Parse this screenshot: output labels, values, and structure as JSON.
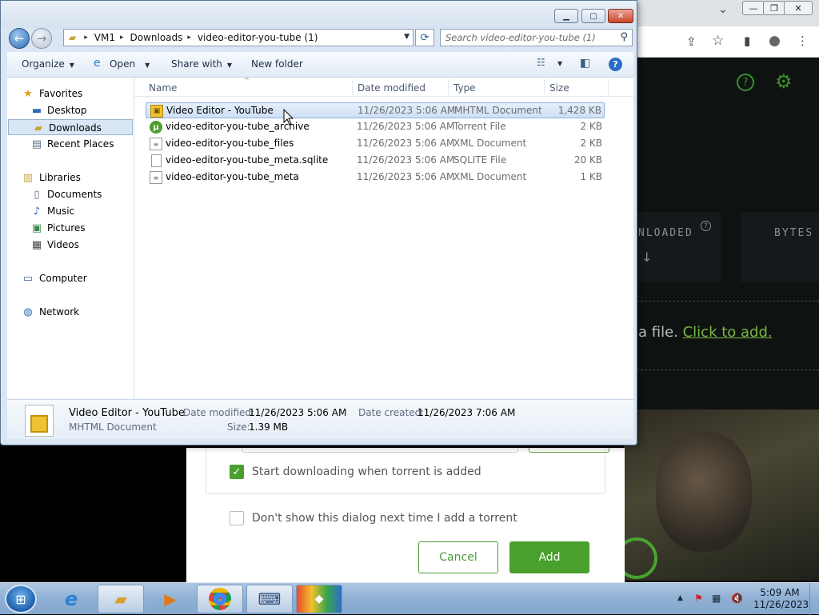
{
  "browser": {
    "min": "—",
    "restore": "❐",
    "close": "✕",
    "share_icon": "⇪",
    "star_icon": "☆",
    "sidepanel_icon": "▮",
    "profile_icon": "●",
    "menu_icon": "⋮",
    "chevron": "⌄"
  },
  "torrent_app": {
    "help_icon": "?",
    "settings_icon": "⚙",
    "stat_downloaded": "NLOADED",
    "stat_bytes": "BYTES",
    "drop_text": "a file. ",
    "drop_link": "Click to add."
  },
  "torrent_dialog": {
    "start_downloading_label": "Start downloading when torrent is added",
    "start_downloading_checked": true,
    "dont_show_label": "Don't show this dialog next time I add a torrent",
    "dont_show_checked": false,
    "cancel_label": "Cancel",
    "add_label": "Add",
    "accent": "#4aa02c"
  },
  "explorer": {
    "window_controls": {
      "minimize": "▁",
      "maximize": "▢",
      "close": "✕"
    },
    "address": {
      "crumbs": [
        "VM1",
        "Downloads",
        "video-editor-you-tube (1)"
      ]
    },
    "search": {
      "placeholder": "Search video-editor-you-tube (1)"
    },
    "toolbar": {
      "organize": "Organize",
      "open": "Open",
      "share_with": "Share with",
      "new_folder": "New folder"
    },
    "nav": {
      "favorites": "Favorites",
      "desktop": "Desktop",
      "downloads": "Downloads",
      "recent_places": "Recent Places",
      "libraries": "Libraries",
      "documents": "Documents",
      "music": "Music",
      "pictures": "Pictures",
      "videos": "Videos",
      "computer": "Computer",
      "network": "Network"
    },
    "columns": {
      "name": "Name",
      "date_modified": "Date modified",
      "type": "Type",
      "size": "Size"
    },
    "files": [
      {
        "name": "Video Editor - YouTube",
        "date": "11/26/2023 5:06 AM",
        "type": "MHTML Document",
        "size": "1,428 KB",
        "icon": "mhtml-icon"
      },
      {
        "name": "video-editor-you-tube_archive",
        "date": "11/26/2023 5:06 AM",
        "type": "Torrent File",
        "size": "2 KB",
        "icon": "torrent-icon"
      },
      {
        "name": "video-editor-you-tube_files",
        "date": "11/26/2023 5:06 AM",
        "type": "XML Document",
        "size": "2 KB",
        "icon": "xml-icon"
      },
      {
        "name": "video-editor-you-tube_meta.sqlite",
        "date": "11/26/2023 5:06 AM",
        "type": "SQLITE File",
        "size": "20 KB",
        "icon": "file-icon"
      },
      {
        "name": "video-editor-you-tube_meta",
        "date": "11/26/2023 5:06 AM",
        "type": "XML Document",
        "size": "1 KB",
        "icon": "xml-icon"
      }
    ],
    "details": {
      "name": "Video Editor - YouTube",
      "type": "MHTML Document",
      "date_modified_key": "Date modified:",
      "date_modified": "11/26/2023 5:06 AM",
      "date_created_key": "Date created:",
      "date_created": "11/26/2023 7:06 AM",
      "size_key": "Size:",
      "size": "1.39 MB"
    }
  },
  "taskbar": {
    "clock_time": "5:09 AM",
    "clock_date": "11/26/2023"
  }
}
